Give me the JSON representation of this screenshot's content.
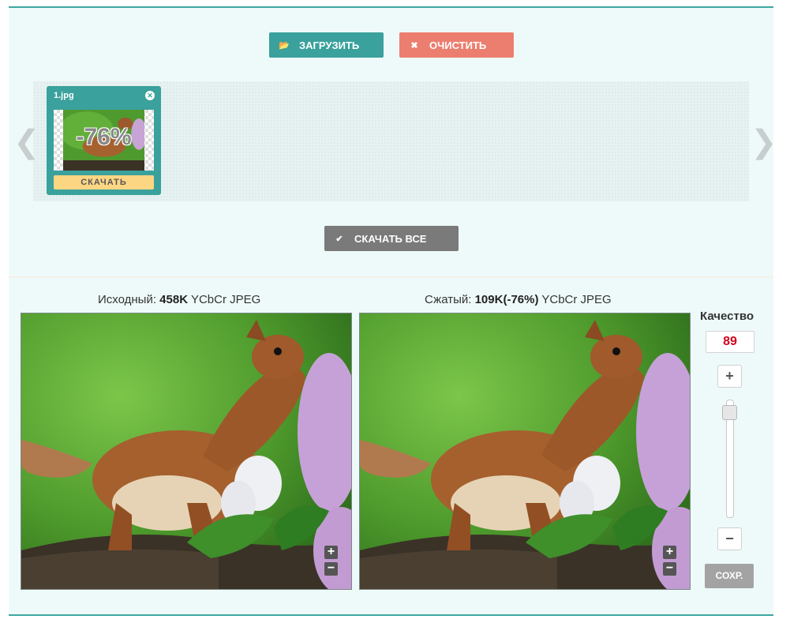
{
  "toolbar": {
    "upload_label": "ЗАГРУЗИТЬ",
    "clear_label": "ОЧИСТИТЬ",
    "download_all_label": "СКАЧАТЬ ВСЕ"
  },
  "queue": {
    "items": [
      {
        "filename": "1.jpg",
        "reduction": "-76%",
        "download_label": "СКАЧАТЬ"
      }
    ]
  },
  "original": {
    "label": "Исходный:",
    "size": "458K",
    "format": "YCbCr JPEG"
  },
  "compressed": {
    "label": "Сжатый:",
    "size": "109K(-76%)",
    "format": "YCbCr JPEG"
  },
  "quality": {
    "title": "Качество",
    "value": "89",
    "level": 0.89,
    "save_label": "СОХР."
  },
  "colors": {
    "accent": "#3aa19c",
    "danger": "#ec7e6f",
    "neutral": "#7a7a7a",
    "download": "#fdd683"
  },
  "icons": {
    "upload": "folder-open-icon",
    "clear": "close-icon",
    "download_all": "check-icon"
  }
}
